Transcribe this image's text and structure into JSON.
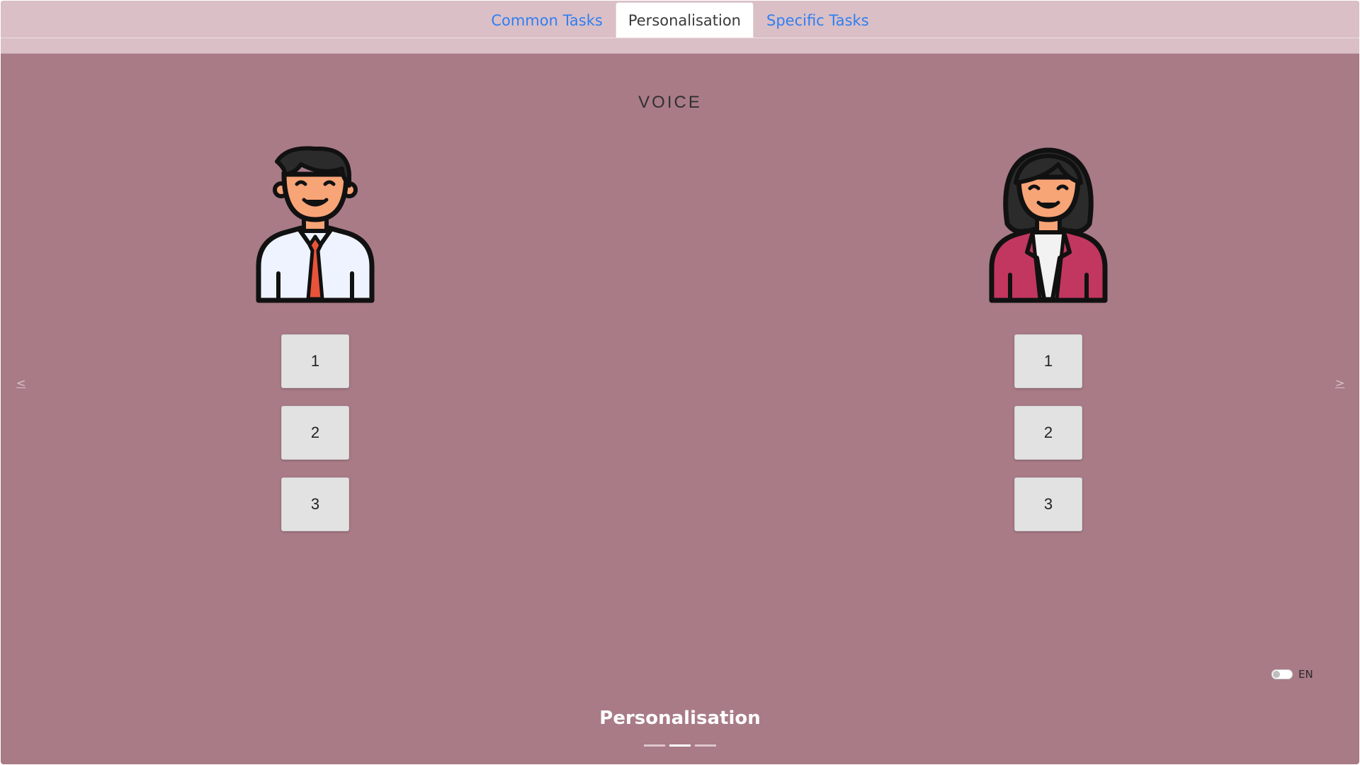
{
  "tabs": [
    {
      "label": "Common Tasks",
      "active": false
    },
    {
      "label": "Personalisation",
      "active": true
    },
    {
      "label": "Specific Tasks",
      "active": false
    }
  ],
  "section_title": "VOICE",
  "voices": {
    "male": {
      "icon": "male-avatar-icon",
      "options": [
        "1",
        "2",
        "3"
      ]
    },
    "female": {
      "icon": "female-avatar-icon",
      "options": [
        "1",
        "2",
        "3"
      ]
    }
  },
  "nav": {
    "prev": "<",
    "next": ">"
  },
  "language": {
    "label": "EN",
    "toggle_on": false
  },
  "slide": {
    "title": "Personalisation",
    "count": 3,
    "current": 2
  },
  "colors": {
    "background": "#a97b87",
    "topbar": "#dabfc6",
    "tab_link": "#2f7ff2",
    "female_jacket": "#c2375f",
    "male_tie": "#e8533a",
    "skin": "#f7a477"
  }
}
